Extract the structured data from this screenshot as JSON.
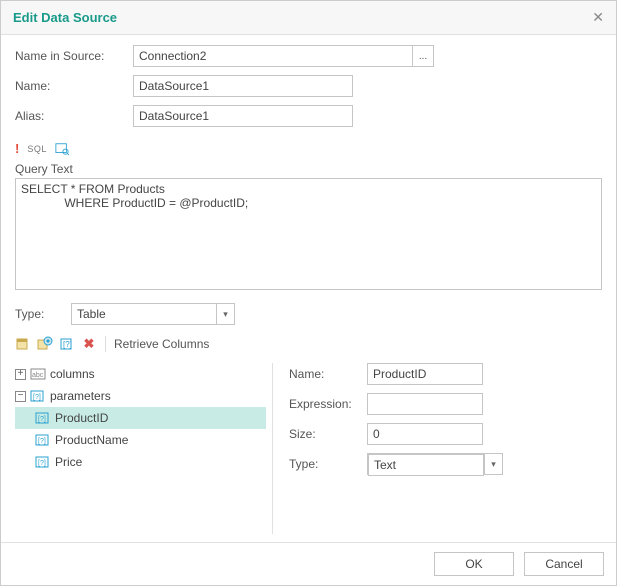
{
  "title": "Edit Data Source",
  "fields": {
    "name_in_source_label": "Name in Source:",
    "name_in_source_value": "Connection2",
    "name_label": "Name:",
    "name_value": "DataSource1",
    "alias_label": "Alias:",
    "alias_value": "DataSource1"
  },
  "toolbar": {
    "sql": "SQL"
  },
  "query": {
    "label": "Query Text",
    "text": "SELECT * FROM Products\n             WHERE ProductID = @ProductID;"
  },
  "type": {
    "label": "Type:",
    "value": "Table"
  },
  "columns_toolbar": {
    "retrieve": "Retrieve Columns"
  },
  "tree": {
    "columns_label": "columns",
    "parameters_label": "parameters",
    "params": [
      "ProductID",
      "ProductName",
      "Price"
    ]
  },
  "props": {
    "name_label": "Name:",
    "name_value": "ProductID",
    "expression_label": "Expression:",
    "expression_value": "",
    "size_label": "Size:",
    "size_value": "0",
    "type_label": "Type:",
    "type_value": "Text"
  },
  "buttons": {
    "ok": "OK",
    "cancel": "Cancel"
  }
}
